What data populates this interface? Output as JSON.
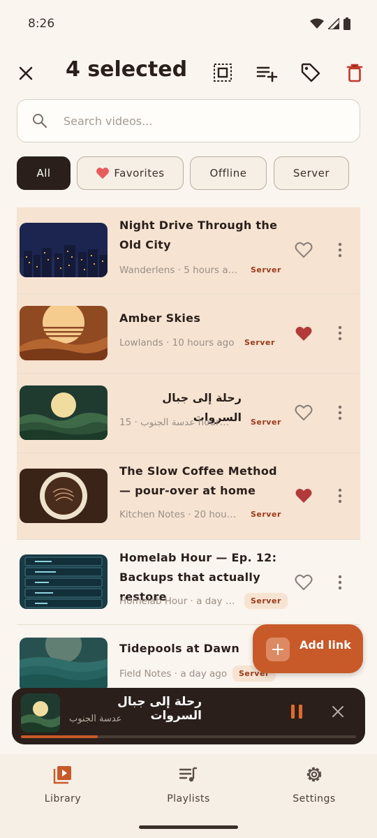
{
  "status_bar": {
    "time": "8:26"
  },
  "header": {
    "title": "4 selected"
  },
  "search": {
    "placeholder": "Search videos..."
  },
  "filters": [
    {
      "label": "All",
      "active": true
    },
    {
      "label": "Favorites",
      "active": false
    },
    {
      "label": "Offline",
      "active": false
    },
    {
      "label": "Server",
      "active": false
    }
  ],
  "videos": [
    {
      "title": "Night Drive Through the Old City",
      "meta": "Wanderlens · 5 hours a…",
      "badge": "Server",
      "favorite": false,
      "selected": true
    },
    {
      "title": "Amber Skies",
      "meta": "Lowlands · 10 hours ago",
      "badge": "Server",
      "favorite": true,
      "selected": true
    },
    {
      "title": "رحلة إلى جبال السروات",
      "meta": "15 · عدسة الجنوب hours …",
      "badge": "Server",
      "favorite": false,
      "selected": true
    },
    {
      "title": "The Slow Coffee Method — pour-over at home",
      "meta": "Kitchen Notes · 20 hour…",
      "badge": "Server",
      "favorite": true,
      "selected": true
    },
    {
      "title": "Homelab Hour — Ep. 12: Backups that actually restore",
      "meta": "Homelab Hour · a day a…",
      "badge": "Server",
      "favorite": false,
      "selected": false
    },
    {
      "title": "Tidepools at Dawn",
      "meta": "Field Notes · a day ago",
      "badge": "Server",
      "favorite": false,
      "selected": false
    }
  ],
  "fab": {
    "label": "Add link"
  },
  "player": {
    "title": "رحلة إلى جبال السروات",
    "subtitle": "عدسة الجنوب",
    "progress": 0.23
  },
  "nav": [
    {
      "label": "Library",
      "icon": "library-icon",
      "active": true
    },
    {
      "label": "Playlists",
      "icon": "playlists-icon",
      "active": false
    },
    {
      "label": "Settings",
      "icon": "settings-icon",
      "active": false
    }
  ],
  "colors": {
    "accent": "#c85a2a",
    "selected_row": "#f6e3d2",
    "favorite": "#b23a3a",
    "dark": "#2a1f1a"
  }
}
